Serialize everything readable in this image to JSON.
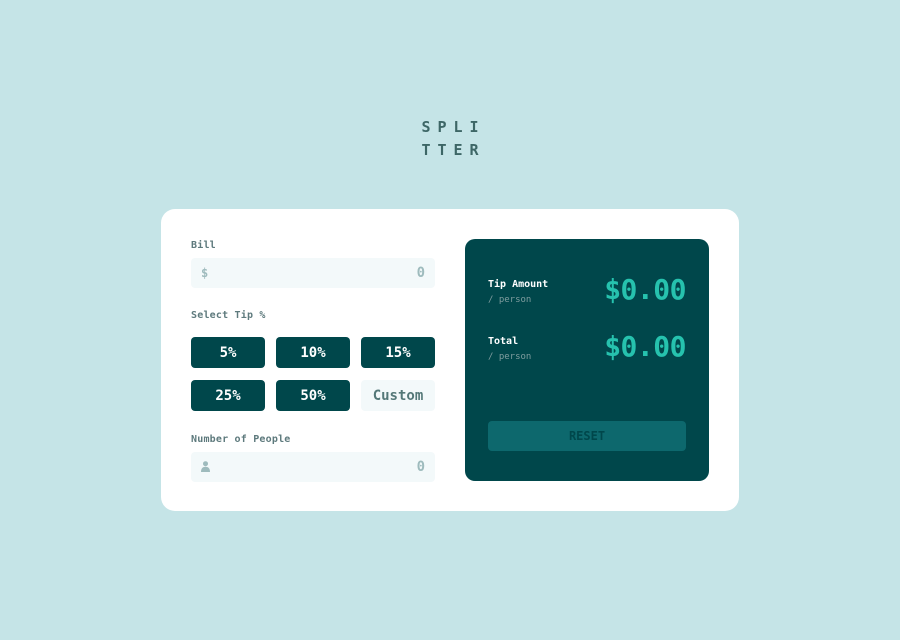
{
  "logo": {
    "line1": "SPLI",
    "line2": "TTER"
  },
  "bill": {
    "label": "Bill",
    "icon": "dollar-icon",
    "icon_glyph": "$",
    "placeholder": "0"
  },
  "tip": {
    "label": "Select Tip %",
    "options": [
      "5%",
      "10%",
      "15%",
      "25%",
      "50%"
    ],
    "custom_label": "Custom"
  },
  "people": {
    "label": "Number of People",
    "icon": "person-icon",
    "placeholder": "0"
  },
  "results": {
    "tip_amount_label": "Tip Amount",
    "tip_amount_sub": "/ person",
    "tip_amount_value": "$0.00",
    "total_label": "Total",
    "total_sub": "/ person",
    "total_value": "$0.00",
    "reset_label": "RESET"
  },
  "colors": {
    "background": "#c5e4e7",
    "card": "#ffffff",
    "dark_green": "#00474b",
    "accent": "#26c2ae",
    "input_bg": "#f3f9fa",
    "reset_disabled": "#0d686d"
  }
}
